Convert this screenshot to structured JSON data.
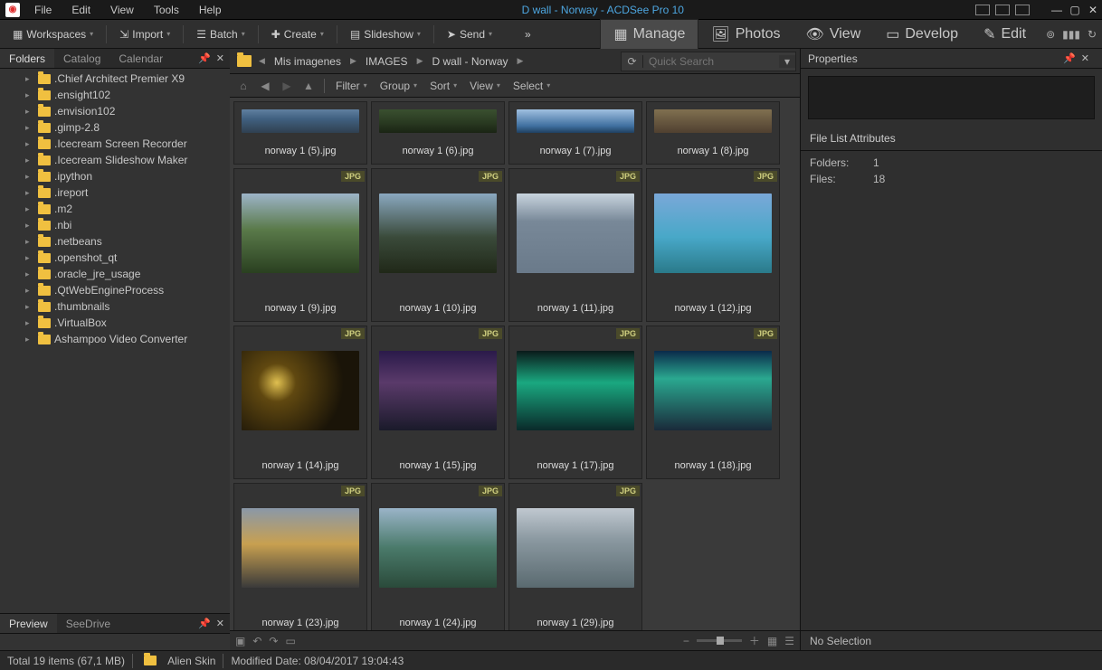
{
  "title": "D wall - Norway - ACDSee Pro 10",
  "menu": {
    "file": "File",
    "edit": "Edit",
    "view": "View",
    "tools": "Tools",
    "help": "Help"
  },
  "toolbar": {
    "workspaces": "Workspaces",
    "import": "Import",
    "batch": "Batch",
    "create": "Create",
    "slideshow": "Slideshow",
    "send": "Send"
  },
  "modes": {
    "manage": "Manage",
    "photos": "Photos",
    "view": "View",
    "develop": "Develop",
    "edit": "Edit"
  },
  "left_tabs": {
    "folders": "Folders",
    "catalog": "Catalog",
    "calendar": "Calendar",
    "preview": "Preview",
    "seedrive": "SeeDrive"
  },
  "folders": [
    ".Chief Architect Premier X9",
    ".ensight102",
    ".envision102",
    ".gimp-2.8",
    ".Icecream Screen Recorder",
    ".Icecream Slideshow Maker",
    ".ipython",
    ".ireport",
    ".m2",
    ".nbi",
    ".netbeans",
    ".openshot_qt",
    ".oracle_jre_usage",
    ".QtWebEngineProcess",
    ".thumbnails",
    ".VirtualBox",
    "Ashampoo Video Converter"
  ],
  "breadcrumbs": [
    "Mis imagenes",
    "IMAGES",
    "D wall - Norway"
  ],
  "search_placeholder": "Quick Search",
  "viewbar": {
    "filter": "Filter",
    "group": "Group",
    "sort": "Sort",
    "view": "View",
    "select": "Select"
  },
  "thumbs_row0": [
    {
      "name": "norway 1 (5).jpg",
      "cls": "grad-n5"
    },
    {
      "name": "norway 1 (6).jpg",
      "cls": "grad-n6"
    },
    {
      "name": "norway 1 (7).jpg",
      "cls": "grad-n7"
    },
    {
      "name": "norway 1 (8).jpg",
      "cls": "grad-n8"
    }
  ],
  "thumbs": [
    {
      "name": "norway 1 (9).jpg",
      "cls": "grad-n9"
    },
    {
      "name": "norway 1 (10).jpg",
      "cls": "grad-n10"
    },
    {
      "name": "norway 1 (11).jpg",
      "cls": "grad-n11"
    },
    {
      "name": "norway 1 (12).jpg",
      "cls": "grad-n12"
    },
    {
      "name": "norway 1 (14).jpg",
      "cls": "grad-n14"
    },
    {
      "name": "norway 1 (15).jpg",
      "cls": "grad-n15"
    },
    {
      "name": "norway 1 (17).jpg",
      "cls": "grad-n17"
    },
    {
      "name": "norway 1 (18).jpg",
      "cls": "grad-n18"
    },
    {
      "name": "norway 1 (23).jpg",
      "cls": "grad-n23"
    },
    {
      "name": "norway 1 (24).jpg",
      "cls": "grad-n24"
    },
    {
      "name": "norway 1 (29).jpg",
      "cls": "grad-n29"
    }
  ],
  "badge": "JPG",
  "props": {
    "title": "Properties",
    "section": "File List Attributes",
    "folders_k": "Folders:",
    "folders_v": "1",
    "files_k": "Files:",
    "files_v": "18",
    "selection": "No Selection"
  },
  "status": {
    "total": "Total 19 items  (67,1 MB)",
    "folder": "Alien Skin",
    "modified": "Modified Date: 08/04/2017 19:04:43"
  }
}
